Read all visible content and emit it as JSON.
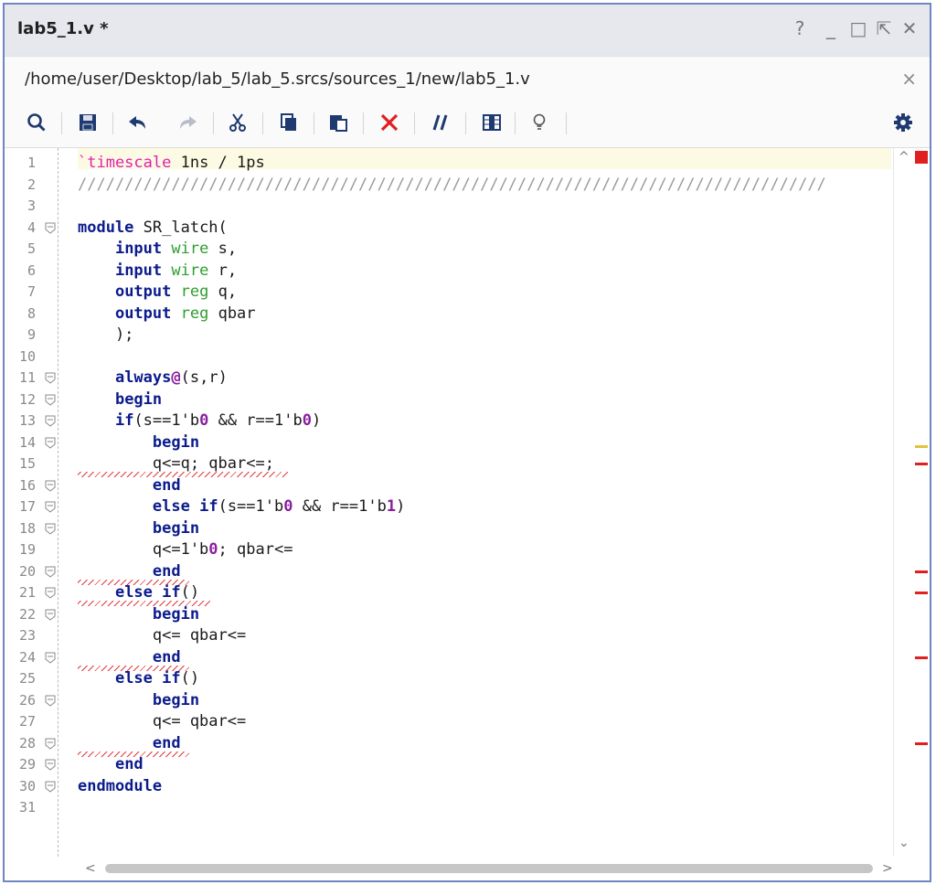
{
  "window": {
    "title": "lab5_1.v *",
    "controls": [
      "?",
      "_",
      "□",
      "⇱",
      "✕"
    ]
  },
  "path_bar": {
    "path": "/home/user/Desktop/lab_5/lab_5.srcs/sources_1/new/lab5_1.v",
    "close_glyph": "×"
  },
  "toolbar": {
    "icons": [
      "search-icon",
      "save-icon",
      "undo-icon",
      "redo-icon",
      "cut-icon",
      "copy-icon",
      "paste-icon",
      "delete-icon",
      "comment-icon",
      "column-icon",
      "bulb-icon",
      "gear-icon"
    ]
  },
  "editor": {
    "line_numbers": [
      "1",
      "2",
      "3",
      "4",
      "5",
      "6",
      "7",
      "8",
      "9",
      "10",
      "11",
      "12",
      "13",
      "14",
      "15",
      "16",
      "17",
      "18",
      "19",
      "20",
      "21",
      "22",
      "23",
      "24",
      "25",
      "26",
      "27",
      "28",
      "29",
      "30",
      "31"
    ],
    "lines": [
      [
        {
          "t": "`timescale",
          "c": "mag"
        },
        {
          "t": " 1ns / 1ps"
        }
      ],
      [
        {
          "t": "////////////////////////////////////////////////////////////////////////////////",
          "c": "cmt"
        }
      ],
      [],
      [
        {
          "t": "module",
          "c": "kw"
        },
        {
          "t": " SR_latch("
        }
      ],
      [
        {
          "t": "    "
        },
        {
          "t": "input",
          "c": "kw"
        },
        {
          "t": " "
        },
        {
          "t": "wire",
          "c": "grn"
        },
        {
          "t": " s,"
        }
      ],
      [
        {
          "t": "    "
        },
        {
          "t": "input",
          "c": "kw"
        },
        {
          "t": " "
        },
        {
          "t": "wire",
          "c": "grn"
        },
        {
          "t": " r,"
        }
      ],
      [
        {
          "t": "    "
        },
        {
          "t": "output",
          "c": "kw"
        },
        {
          "t": " "
        },
        {
          "t": "reg",
          "c": "grn"
        },
        {
          "t": " q,"
        }
      ],
      [
        {
          "t": "    "
        },
        {
          "t": "output",
          "c": "kw"
        },
        {
          "t": " "
        },
        {
          "t": "reg",
          "c": "grn"
        },
        {
          "t": " qbar"
        }
      ],
      [
        {
          "t": "    );"
        }
      ],
      [],
      [
        {
          "t": "    "
        },
        {
          "t": "always",
          "c": "kw"
        },
        {
          "t": "@",
          "c": "pur"
        },
        {
          "t": "(s,r)"
        }
      ],
      [
        {
          "t": "    "
        },
        {
          "t": "begin",
          "c": "kw"
        }
      ],
      [
        {
          "t": "    "
        },
        {
          "t": "if",
          "c": "kw"
        },
        {
          "t": "(s==1'b"
        },
        {
          "t": "0",
          "c": "pur"
        },
        {
          "t": " && r==1'b"
        },
        {
          "t": "0",
          "c": "pur"
        },
        {
          "t": ")"
        }
      ],
      [
        {
          "t": "        "
        },
        {
          "t": "begin",
          "c": "kw"
        }
      ],
      [
        {
          "t": "        q<=q; qbar<=;"
        }
      ],
      [
        {
          "t": "        "
        },
        {
          "t": "end",
          "c": "kw"
        }
      ],
      [
        {
          "t": "        "
        },
        {
          "t": "else",
          "c": "kw"
        },
        {
          "t": " "
        },
        {
          "t": "if",
          "c": "kw"
        },
        {
          "t": "(s==1'b"
        },
        {
          "t": "0",
          "c": "pur"
        },
        {
          "t": " && r==1'b"
        },
        {
          "t": "1",
          "c": "pur"
        },
        {
          "t": ")"
        }
      ],
      [
        {
          "t": "        "
        },
        {
          "t": "begin",
          "c": "kw"
        }
      ],
      [
        {
          "t": "        q<=1'b"
        },
        {
          "t": "0",
          "c": "pur"
        },
        {
          "t": "; qbar<="
        }
      ],
      [
        {
          "t": "        "
        },
        {
          "t": "end",
          "c": "kw"
        }
      ],
      [
        {
          "t": "    "
        },
        {
          "t": "else",
          "c": "kw"
        },
        {
          "t": " "
        },
        {
          "t": "if",
          "c": "kw"
        },
        {
          "t": "()"
        }
      ],
      [
        {
          "t": "        "
        },
        {
          "t": "begin",
          "c": "kw"
        }
      ],
      [
        {
          "t": "        q<= qbar<="
        }
      ],
      [
        {
          "t": "        "
        },
        {
          "t": "end",
          "c": "kw"
        }
      ],
      [
        {
          "t": "    "
        },
        {
          "t": "else",
          "c": "kw"
        },
        {
          "t": " "
        },
        {
          "t": "if",
          "c": "kw"
        },
        {
          "t": "()"
        }
      ],
      [
        {
          "t": "        "
        },
        {
          "t": "begin",
          "c": "kw"
        }
      ],
      [
        {
          "t": "        q<= qbar<="
        }
      ],
      [
        {
          "t": "        "
        },
        {
          "t": "end",
          "c": "kw"
        }
      ],
      [
        {
          "t": "    "
        },
        {
          "t": "end",
          "c": "kw"
        }
      ],
      [
        {
          "t": "endmodule",
          "c": "kw"
        }
      ],
      []
    ],
    "fold_lines": [
      "4",
      "11",
      "12",
      "13",
      "14",
      "16",
      "17",
      "18",
      "20",
      "21",
      "22",
      "24",
      "26",
      "28",
      "29",
      "30"
    ],
    "error_lines": [
      "15",
      "20",
      "21",
      "24",
      "28"
    ],
    "warning_line": "14",
    "current_line": "31"
  },
  "colors": {
    "keyword": "#0b1b8c",
    "type": "#2e9d2e",
    "number": "#8a1fa0",
    "directive": "#e020b0",
    "error": "#e02020",
    "warning": "#e6c23a",
    "window_border": "#6f86c2"
  },
  "scrollbars": {
    "up_glyph": "^",
    "down_glyph": "⌄",
    "left_glyph": "<",
    "right_glyph": ">"
  }
}
